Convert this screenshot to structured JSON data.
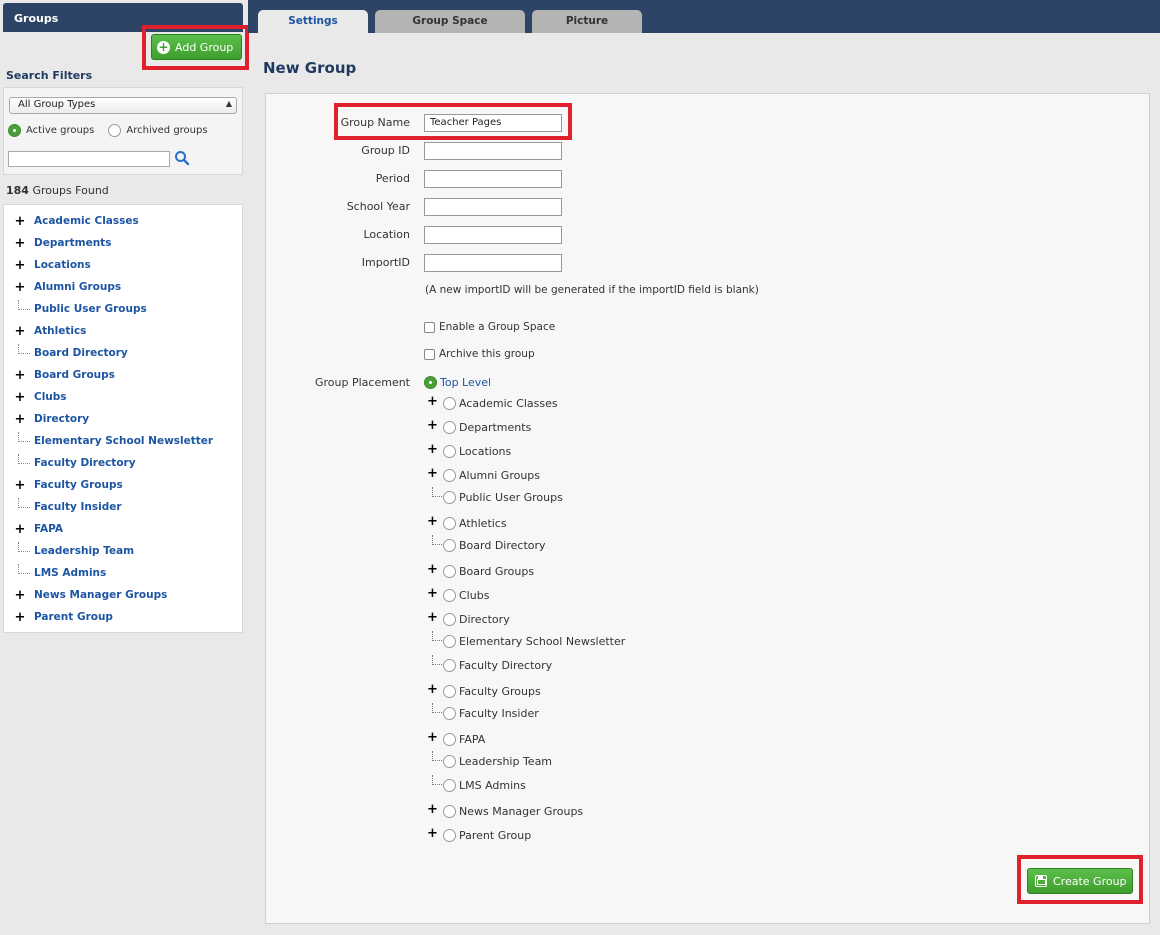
{
  "sidebar": {
    "title": "Groups",
    "add_group_label": "Add Group",
    "search_filters_title": "Search Filters",
    "group_type_select": "All Group Types",
    "active_label": "Active groups",
    "archived_label": "Archived groups",
    "search_value": "",
    "found_count": "184",
    "found_text": "Groups Found",
    "tree": [
      {
        "label": "Academic Classes",
        "expandable": true
      },
      {
        "label": "Departments",
        "expandable": true
      },
      {
        "label": "Locations",
        "expandable": true
      },
      {
        "label": "Alumni Groups",
        "expandable": true
      },
      {
        "label": "Public User Groups",
        "expandable": false
      },
      {
        "label": "Athletics",
        "expandable": true
      },
      {
        "label": "Board Directory",
        "expandable": false
      },
      {
        "label": "Board Groups",
        "expandable": true
      },
      {
        "label": "Clubs",
        "expandable": true
      },
      {
        "label": "Directory",
        "expandable": true
      },
      {
        "label": "Elementary School Newsletter",
        "expandable": false
      },
      {
        "label": "Faculty Directory",
        "expandable": false
      },
      {
        "label": "Faculty Groups",
        "expandable": true
      },
      {
        "label": "Faculty Insider",
        "expandable": false
      },
      {
        "label": "FAPA",
        "expandable": true
      },
      {
        "label": "Leadership Team",
        "expandable": false
      },
      {
        "label": "LMS Admins",
        "expandable": false
      },
      {
        "label": "News Manager Groups",
        "expandable": true
      },
      {
        "label": "Parent Group",
        "expandable": true
      }
    ]
  },
  "tabs": [
    {
      "label": "Settings",
      "active": true
    },
    {
      "label": "Group Space",
      "active": false
    },
    {
      "label": "Picture",
      "active": false
    }
  ],
  "page_title": "New Group",
  "form": {
    "group_name_label": "Group Name",
    "group_name_value": "Teacher Pages",
    "group_id_label": "Group ID",
    "period_label": "Period",
    "school_year_label": "School Year",
    "location_label": "Location",
    "import_id_label": "ImportID",
    "import_note": "(A new importID will be generated if the importID field is blank)",
    "enable_space_label": "Enable a Group Space",
    "archive_label": "Archive this group",
    "placement_label": "Group Placement",
    "top_level_label": "Top Level",
    "create_button_label": "Create Group"
  },
  "colors": {
    "header_navy": "#2e4466",
    "link_blue": "#1d55a3",
    "button_green": "#4aa83a",
    "highlight_red": "#e0202c"
  }
}
